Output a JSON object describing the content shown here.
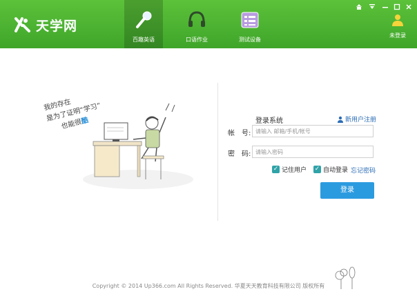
{
  "app": {
    "logo_text": "天学网"
  },
  "nav": [
    {
      "label": "百趣英语",
      "icon": "microphone-icon",
      "active": true
    },
    {
      "label": "口语作业",
      "icon": "headphones-icon",
      "active": false
    },
    {
      "label": "测试设备",
      "icon": "checklist-icon",
      "active": false
    }
  ],
  "window_controls": [
    "home-icon",
    "menu-icon",
    "minimize-icon",
    "close-icon"
  ],
  "user": {
    "label": "未登录",
    "icon": "user-icon"
  },
  "illustration": {
    "line1": "我的存在",
    "line2": "是为了证明“学习”",
    "line3_prefix": "也能很",
    "line3_highlight": "酷"
  },
  "login": {
    "title": "登录系统",
    "register_link": "新用户注册",
    "account_label": "帐　号:",
    "account_placeholder": "请输入 邮箱/手机/帐号",
    "password_label": "密　码:",
    "password_placeholder": "请输入密码",
    "remember_label": "记住用户",
    "auto_login_label": "自动登录",
    "forgot_link": "忘记密码",
    "submit_label": "登录"
  },
  "footer": {
    "text": "Copyright © 2014 Up366.com All Rights Reserved. 华夏天天教育科技有限公司 版权所有"
  },
  "colors": {
    "header_green": "#4cb231",
    "button_blue": "#2b9be0",
    "link_blue": "#2a6cb5",
    "checkbox_teal": "#2fa3a8"
  }
}
